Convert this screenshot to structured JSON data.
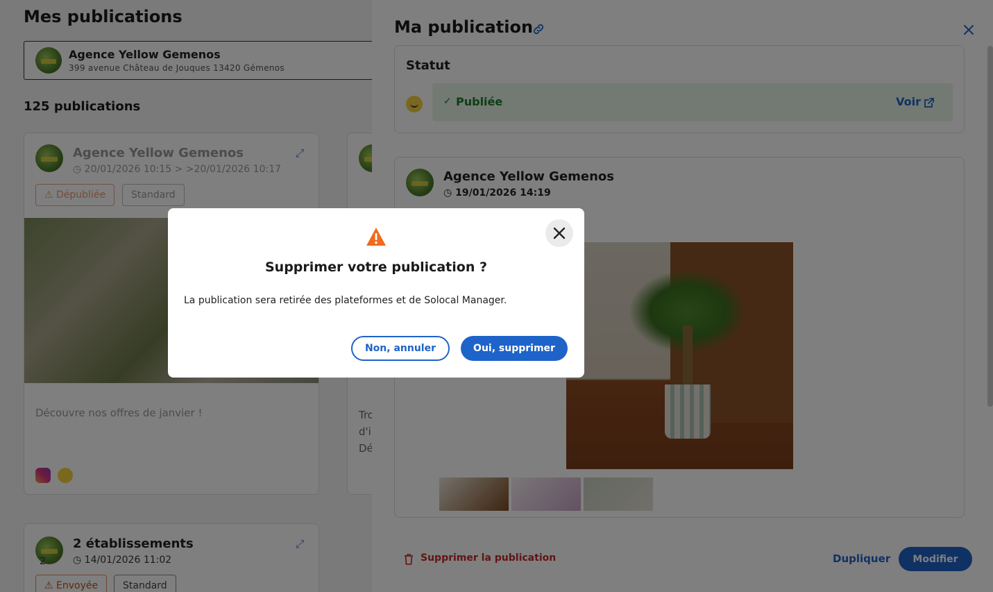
{
  "page": {
    "title": "Mes publications",
    "establishment": {
      "name": "Agence Yellow Gemenos",
      "address": "399 avenue Château de Jouques 13420 Gémenos"
    },
    "count_label": "125 publications",
    "cards": [
      {
        "name": "Agence Yellow Gemenos",
        "date": "20/01/2026 10:15 > >20/01/2026 10:17",
        "tags": [
          "Dépubliée",
          "Standard"
        ],
        "text": "Découvre nos offres de janvier !"
      },
      {
        "name": "2 établissements",
        "date": "14/01/2026 11:02",
        "avatar_count": "2",
        "tags": [
          "Envoyée",
          "Standard"
        ]
      }
    ],
    "partial_card_text": [
      "Tro",
      "d'i",
      "Dé"
    ]
  },
  "drawer": {
    "title": "Ma publication",
    "status_label": "Statut",
    "status_value": "Publiée",
    "view_label": "Voir",
    "preview": {
      "name": "Agence Yellow Gemenos",
      "date": "19/01/2026 14:19"
    },
    "footer": {
      "delete_label": "Supprimer la publication",
      "duplicate_label": "Dupliquer",
      "edit_label": "Modifier"
    }
  },
  "modal": {
    "title": "Supprimer votre publication ?",
    "message": "La publication sera retirée des plateformes et de Solocal Manager.",
    "cancel_label": "Non, annuler",
    "confirm_label": "Oui, supprimer"
  },
  "colors": {
    "primary": "#1e63c9",
    "success_bg": "#e7f5e6",
    "success_text": "#1f7a2a",
    "danger": "#c62828",
    "warning": "#f26a1b"
  }
}
